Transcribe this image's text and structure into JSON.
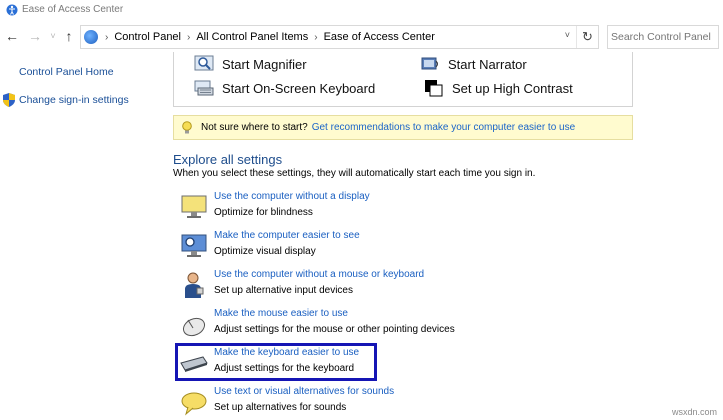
{
  "window": {
    "title": "Ease of Access Center"
  },
  "address": {
    "breadcrumbs": [
      "Control Panel",
      "All Control Panel Items",
      "Ease of Access Center"
    ],
    "search_placeholder": "Search Control Panel"
  },
  "left_pane": {
    "links": [
      "Control Panel Home",
      "Change sign-in settings"
    ]
  },
  "quick_tools": {
    "magnifier": "Start Magnifier",
    "narrator": "Start Narrator",
    "keyboard": "Start On-Screen Keyboard",
    "contrast": "Set up High Contrast"
  },
  "tip": {
    "text": "Not sure where to start?",
    "link": "Get recommendations to make your computer easier to use"
  },
  "explore": {
    "heading": "Explore all settings",
    "description": "When you select these settings, they will automatically start each time you sign in.",
    "settings": [
      {
        "title": "Use the computer without a display",
        "desc": "Optimize for blindness"
      },
      {
        "title": "Make the computer easier to see",
        "desc": "Optimize visual display"
      },
      {
        "title": "Use the computer without a mouse or keyboard",
        "desc": "Set up alternative input devices"
      },
      {
        "title": "Make the mouse easier to use",
        "desc": "Adjust settings for the mouse or other pointing devices"
      },
      {
        "title": "Make the keyboard easier to use",
        "desc": "Adjust settings for the keyboard"
      },
      {
        "title": "Use text or visual alternatives for sounds",
        "desc": "Set up alternatives for sounds"
      }
    ]
  },
  "watermark": "wsxdn.com",
  "colors": {
    "link": "#1a5fc1",
    "heading": "#1e4d8c",
    "highlight": "#1515b4",
    "tip_bg": "#fffbcf"
  }
}
